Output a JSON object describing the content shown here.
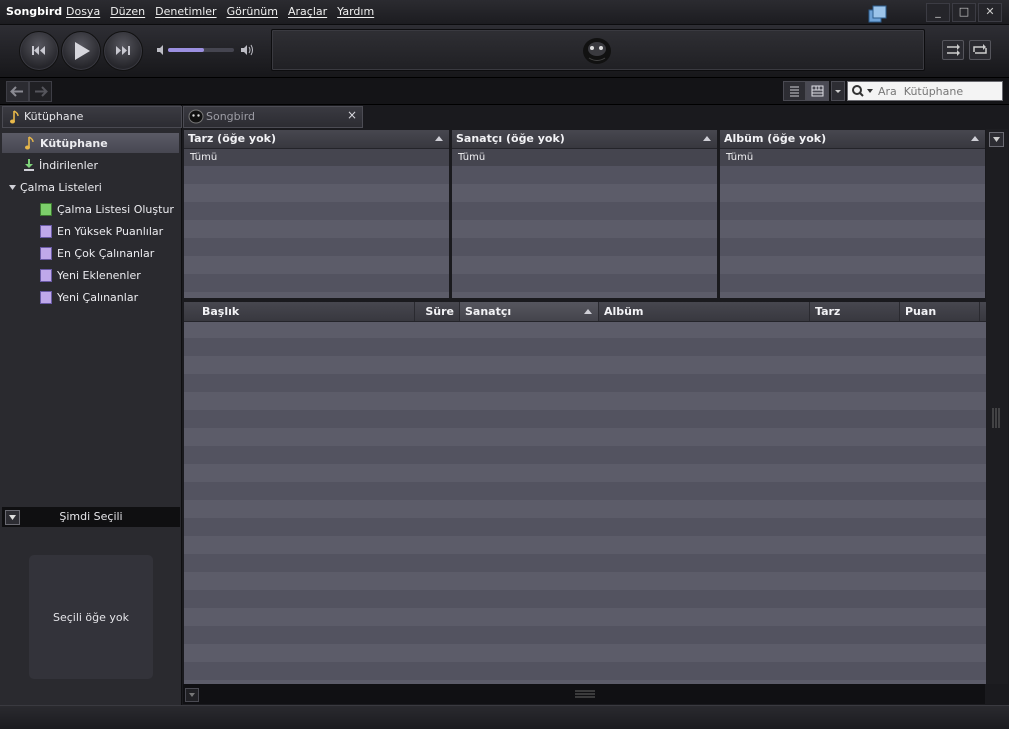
{
  "app": {
    "title": "Songbird"
  },
  "menu": [
    "Dosya",
    "Düzen",
    "Denetimler",
    "Görünüm",
    "Araçlar",
    "Yardım"
  ],
  "window_controls": {
    "minimize": "_",
    "maximize": "□",
    "close": "✕"
  },
  "search": {
    "placeholder": "Ara  Kütüphane"
  },
  "sidebar": {
    "header": "Kütüphane",
    "library": "Kütüphane",
    "downloads": "İndirilenler",
    "playlists_group": "Çalma Listeleri",
    "playlists": [
      "Çalma Listesi Oluştur",
      "En Yüksek Puanlılar",
      "En Çok Çalınanlar",
      "Yeni Eklenenler",
      "Yeni Çalınanlar"
    ],
    "now_selected_header": "Şimdi Seçili",
    "now_selected_empty": "Seçili öğe yok"
  },
  "tab": {
    "label": "Songbird",
    "close": "×"
  },
  "filters": [
    {
      "title": "Tarz (öğe yok)",
      "all": "Tümü"
    },
    {
      "title": "Sanatçı (öğe yok)",
      "all": "Tümü"
    },
    {
      "title": "Albüm (öğe yok)",
      "all": "Tümü"
    }
  ],
  "tracklist": {
    "columns": [
      "Başlık",
      "Süre",
      "Sanatçı",
      "Albüm",
      "Tarz",
      "Puan"
    ]
  },
  "player": {
    "volume": 0.55
  },
  "colors": {
    "accent": "#9b8fe0",
    "background": "#1a1a1e",
    "row_light": "#5c5c69",
    "row_dark": "#535360"
  }
}
